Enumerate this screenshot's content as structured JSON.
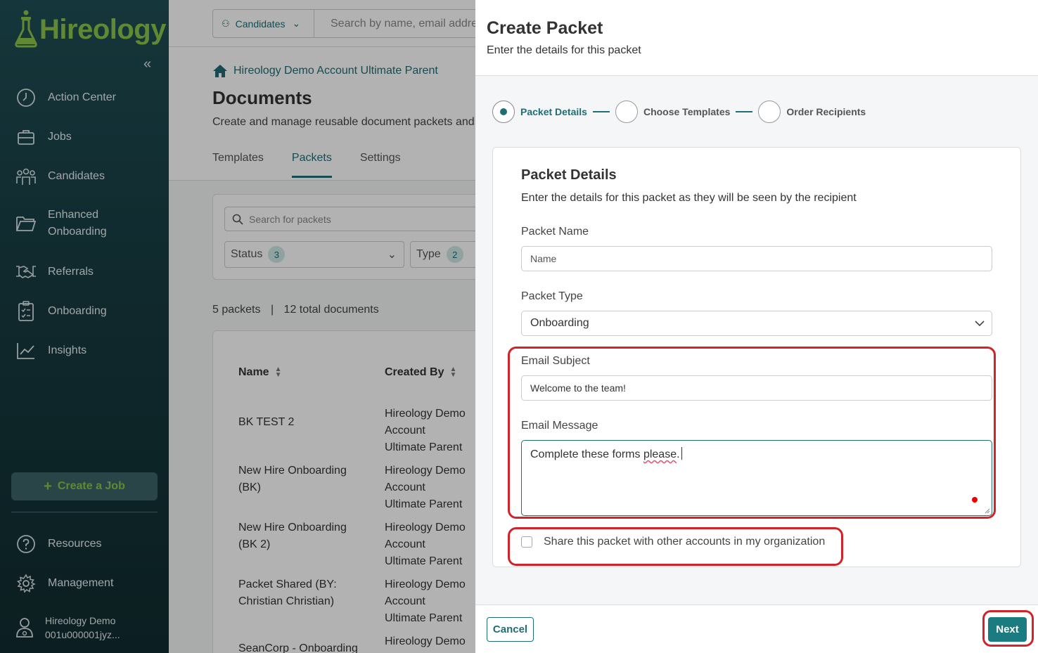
{
  "brand": {
    "name": "Hireology",
    "accent": "#8bc34a",
    "primary": "#1f6e74"
  },
  "sidebar": {
    "items": [
      {
        "label": "Action Center",
        "icon": "clock-icon"
      },
      {
        "label": "Jobs",
        "icon": "briefcase-icon"
      },
      {
        "label": "Candidates",
        "icon": "people-icon"
      },
      {
        "label": "Enhanced Onboarding",
        "line1": "Enhanced",
        "line2": "Onboarding",
        "icon": "folder-icon"
      },
      {
        "label": "Referrals",
        "icon": "handshake-icon"
      },
      {
        "label": "Onboarding",
        "icon": "clipboard-icon"
      },
      {
        "label": "Insights",
        "icon": "chart-icon"
      }
    ],
    "create_job": "Create a Job",
    "resources": "Resources",
    "management": "Management",
    "user_line1": "Hireology Demo",
    "user_line2": "001u000001jyz..."
  },
  "topbar": {
    "scope": "Candidates",
    "search_placeholder": "Search by name, email address"
  },
  "main": {
    "breadcrumb": "Hireology Demo Account Ultimate Parent",
    "title": "Documents",
    "subtitle": "Create and manage reusable document packets and templates",
    "tabs": [
      "Templates",
      "Packets",
      "Settings"
    ],
    "search_placeholder": "Search for packets",
    "filters": [
      {
        "label": "Status",
        "count": "3"
      },
      {
        "label": "Type",
        "count": "2"
      }
    ],
    "count_packets": "5 packets",
    "count_sep": "|",
    "count_docs": "12 total documents",
    "columns": [
      "Name",
      "Created By"
    ],
    "rows": [
      {
        "name1": "BK TEST 2",
        "name2": "",
        "by1": "Hireology Demo Account",
        "by2": "Ultimate Parent"
      },
      {
        "name1": "New Hire Onboarding",
        "name2": "(BK)",
        "by1": "Hireology Demo Account",
        "by2": "Ultimate Parent"
      },
      {
        "name1": "New Hire Onboarding",
        "name2": "(BK 2)",
        "by1": "Hireology Demo Account",
        "by2": "Ultimate Parent"
      },
      {
        "name1": "Packet Shared (BY:",
        "name2": "Christian Christian)",
        "by1": "Hireology Demo Account",
        "by2": "Ultimate Parent"
      },
      {
        "name1": "SeanCorp - Onboarding",
        "name2": "",
        "by1": "Hireology Demo Account",
        "by2": ""
      }
    ]
  },
  "panel": {
    "title": "Create Packet",
    "subtitle": "Enter the details for this packet",
    "steps": [
      "Packet Details",
      "Choose Templates",
      "Order Recipients"
    ],
    "card_title": "Packet Details",
    "card_subtitle": "Enter the details for this packet as they will be seen by the recipient",
    "name_label": "Packet Name",
    "name_placeholder": "Name",
    "type_label": "Packet Type",
    "type_value": "Onboarding",
    "subject_label": "Email Subject",
    "subject_value": "Welcome to the team!",
    "message_label": "Email Message",
    "message_value_prefix": "Complete these forms ",
    "message_value_misspelled": "please",
    "message_value_suffix": ".",
    "share_label": "Share this packet with other accounts in my organization",
    "cancel": "Cancel",
    "next": "Next"
  }
}
